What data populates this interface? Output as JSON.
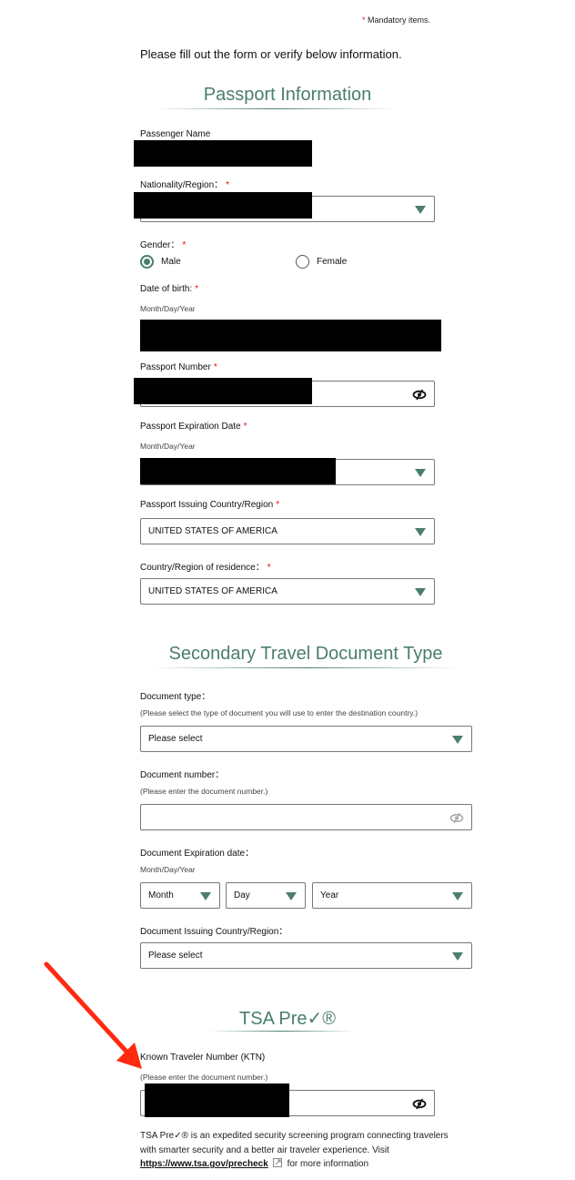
{
  "header": {
    "mandatory_star": "*",
    "mandatory_text": "Mandatory items.",
    "intro": "Please fill out the form or verify below information."
  },
  "passport": {
    "title": "Passport Information",
    "passenger_name": {
      "label": "Passenger Name",
      "value": "[redacted]"
    },
    "nationality": {
      "label": "Nationality/Region：",
      "required": "*",
      "value": "[redacted]"
    },
    "gender": {
      "label": "Gender：",
      "required": "*",
      "options": [
        {
          "label": "Male",
          "selected": true
        },
        {
          "label": "Female",
          "selected": false
        }
      ]
    },
    "dob": {
      "label": "Date of birth:",
      "required": "*",
      "hint": "Month/Day/Year",
      "value": "[redacted]"
    },
    "passport_number": {
      "label": "Passport Number",
      "required": "*",
      "value": "[redacted]",
      "icon": "eye-slash-icon"
    },
    "expiration": {
      "label": "Passport Expiration Date",
      "required": "*",
      "hint": "Month/Day/Year",
      "value": "[redacted]"
    },
    "issuing_country": {
      "label": "Passport Issuing Country/Region",
      "required": "*",
      "value": "UNITED STATES OF AMERICA"
    },
    "residence": {
      "label": "Country/Region of residence：",
      "required": "*",
      "value": "UNITED STATES OF AMERICA"
    }
  },
  "secondary": {
    "title": "Secondary Travel Document Type",
    "doc_type": {
      "label": "Document type：",
      "hint": "(Please select the type of document you will use to enter the destination country.)",
      "value": "Please select"
    },
    "doc_number": {
      "label": "Document number：",
      "hint": "(Please enter the document number.)",
      "value": "",
      "icon": "eye-slash-icon"
    },
    "doc_expiration": {
      "label": "Document Expiration date：",
      "hint": "Month/Day/Year",
      "month": "Month",
      "day": "Day",
      "year": "Year"
    },
    "doc_issuing": {
      "label": "Document Issuing Country/Region：",
      "value": "Please select"
    }
  },
  "tsa": {
    "title": "TSA Pre✓®",
    "ktn": {
      "label": "Known Traveler Number (KTN)",
      "hint": "(Please enter the document number.)",
      "value": "[redacted]",
      "icon": "eye-slash-icon"
    },
    "desc_part1": "TSA Pre✓® is an expedited security screening program connecting travelers with smarter security and a better air traveler experience. Visit ",
    "link": "https://www.tsa.gov/precheck",
    "desc_part2": "for more information"
  },
  "colors": {
    "accent": "#4a7f6a",
    "required": "#e01010",
    "annotation_arrow": "#ff2a10"
  }
}
